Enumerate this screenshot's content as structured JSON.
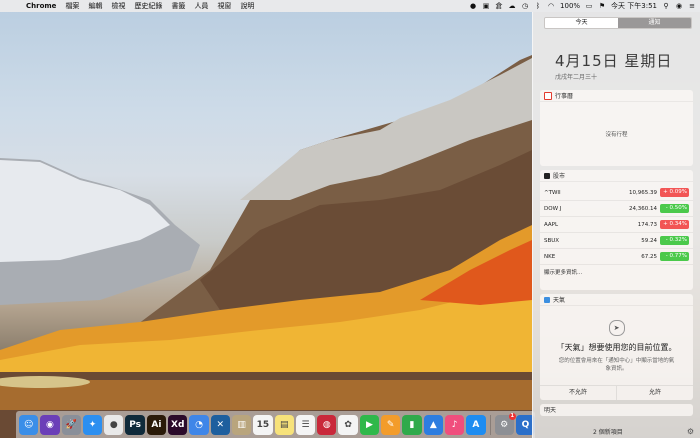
{
  "menubar": {
    "app_name": "Chrome",
    "items": [
      "檔案",
      "編輯",
      "檢視",
      "歷史紀錄",
      "書籤",
      "人員",
      "視窗",
      "說明"
    ],
    "battery": "100%",
    "clock": "今天 下午3:51"
  },
  "notification_center": {
    "tabs": [
      {
        "label": "今天",
        "active": true
      },
      {
        "label": "通知",
        "active": false
      }
    ],
    "date": "4月15日 星期日",
    "lunar_date": "戊戌年二月三十",
    "calendar": {
      "title": "行事曆",
      "empty_text": "沒有行程",
      "accent": "#e23b2e"
    },
    "stocks": {
      "title": "股市",
      "rows": [
        {
          "symbol": "^TWII",
          "price": "10,965.39",
          "change": "+ 0.09%",
          "color": "#f25555"
        },
        {
          "symbol": "DOW J",
          "price": "24,360.14",
          "change": "- 0.50%",
          "color": "#4bc94b"
        },
        {
          "symbol": "AAPL",
          "price": "174.73",
          "change": "+ 0.34%",
          "color": "#f25555"
        },
        {
          "symbol": "SBUX",
          "price": "59.24",
          "change": "- 0.32%",
          "color": "#4bc94b"
        },
        {
          "symbol": "NKE",
          "price": "67.25",
          "change": "- 0.77%",
          "color": "#4bc94b"
        }
      ],
      "more_label": "顯示更多資訊..."
    },
    "weather": {
      "title": "天氣",
      "prompt_title": "「天氣」想要使用您的目前位置。",
      "prompt_body": "您的位置會用來在「通知中心」中顯示當地的氣象資訊。",
      "deny_label": "不允許",
      "allow_label": "允許"
    },
    "tomorrow_label": "明天",
    "new_items": "2 個新項目"
  },
  "dock": {
    "apps": [
      {
        "name": "finder-icon",
        "glyph": "☺",
        "bg": "#3a8ee8"
      },
      {
        "name": "siri-icon",
        "glyph": "◉",
        "bg": "#6b3fb8"
      },
      {
        "name": "launchpad-icon",
        "glyph": "🚀",
        "bg": "#8a8f99"
      },
      {
        "name": "safari-icon",
        "glyph": "✦",
        "bg": "#2c8ff0"
      },
      {
        "name": "chrome-icon",
        "glyph": "●",
        "bg": "#e9e9e9"
      },
      {
        "name": "photoshop-icon",
        "glyph": "Ps",
        "bg": "#0f2a3a"
      },
      {
        "name": "illustrator-icon",
        "glyph": "Ai",
        "bg": "#2a1a08"
      },
      {
        "name": "xd-icon",
        "glyph": "Xd",
        "bg": "#2b0a2a"
      },
      {
        "name": "messenger-icon",
        "glyph": "◔",
        "bg": "#3f86e8"
      },
      {
        "name": "vscode-icon",
        "glyph": "✕",
        "bg": "#1e5f9e"
      },
      {
        "name": "file-icon",
        "glyph": "▥",
        "bg": "#b9a57d"
      },
      {
        "name": "calendar-icon",
        "glyph": "15",
        "bg": "#f4f4f4"
      },
      {
        "name": "notes-icon",
        "glyph": "▤",
        "bg": "#f7e27a"
      },
      {
        "name": "reminders-icon",
        "glyph": "☰",
        "bg": "#f4f4f4"
      },
      {
        "name": "photo-booth-icon",
        "glyph": "◍",
        "bg": "#c9283a"
      },
      {
        "name": "photos-icon",
        "glyph": "✿",
        "bg": "#f4f4f4"
      },
      {
        "name": "facetime-icon",
        "glyph": "▶",
        "bg": "#2fb84a"
      },
      {
        "name": "pages-icon",
        "glyph": "✎",
        "bg": "#f39c2b"
      },
      {
        "name": "numbers-icon",
        "glyph": "▮",
        "bg": "#2faa4b"
      },
      {
        "name": "keynote-icon",
        "glyph": "▲",
        "bg": "#2d7de0"
      },
      {
        "name": "itunes-icon",
        "glyph": "♪",
        "bg": "#f04e7d"
      },
      {
        "name": "app-store-icon",
        "glyph": "A",
        "bg": "#1e8cf0"
      },
      {
        "name": "system-preferences-icon",
        "glyph": "⚙",
        "bg": "#8d8f94",
        "badge": "1"
      },
      {
        "name": "app-icon",
        "glyph": "Q",
        "bg": "#2b6fc9"
      }
    ]
  }
}
